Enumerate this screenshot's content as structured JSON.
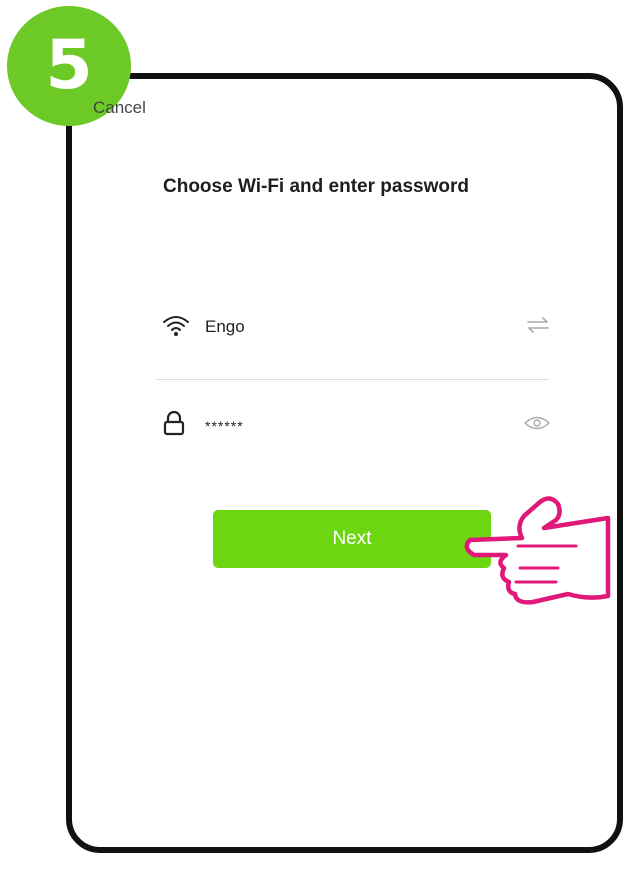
{
  "step": {
    "number": "5"
  },
  "header": {
    "cancel_label": "Cancel"
  },
  "main": {
    "title": "Choose Wi-Fi and enter password",
    "wifi": {
      "ssid": "Engo",
      "icon": "wifi-icon",
      "action_icon": "switch-network-icon"
    },
    "password": {
      "value": "******",
      "icon": "lock-icon",
      "action_icon": "eye-icon"
    },
    "next_label": "Next"
  },
  "colors": {
    "badge": "#6cc926",
    "button": "#6cd611",
    "hand": "#e0187a",
    "frame": "#111111"
  }
}
